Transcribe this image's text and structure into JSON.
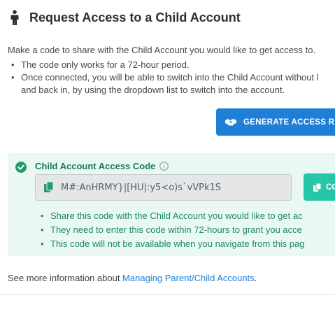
{
  "header": {
    "title": "Request Access to a Child Account",
    "icon": "person-standing-icon"
  },
  "intro": {
    "text": "Make a code to share with the Child Account you would like to get access to.",
    "bullets": [
      "The code only works for a 72-hour period.",
      "Once connected, you will be able to switch into the Child Account without l",
      "and back in, by using the dropdown list to switch into the account."
    ]
  },
  "generate_button": {
    "label": "GENERATE ACCESS REQ",
    "icon": "handshake-icon",
    "color": "#1f7fd6"
  },
  "code_panel": {
    "background": "#eaf8f3",
    "label": "Child Account Access Code",
    "status_icon": "check-circle-icon",
    "info_icon": "info-icon",
    "code_value": "M#:AnHRMY}|[HU|:y5<o)s`vVPk1S",
    "field_icon": "clipboard-icon",
    "copy_button": {
      "label": "CO",
      "icon": "copy-icon",
      "color": "#26c6a8"
    },
    "notes": [
      "Share this code with the Child Account you would like to get ac",
      "They need to enter this code within 72-hours to grant you acce",
      "This code will not be available when you navigate from this pag"
    ]
  },
  "more_info": {
    "prefix": "See more information about ",
    "link_text": "Managing Parent/Child Accounts",
    "suffix": "."
  }
}
